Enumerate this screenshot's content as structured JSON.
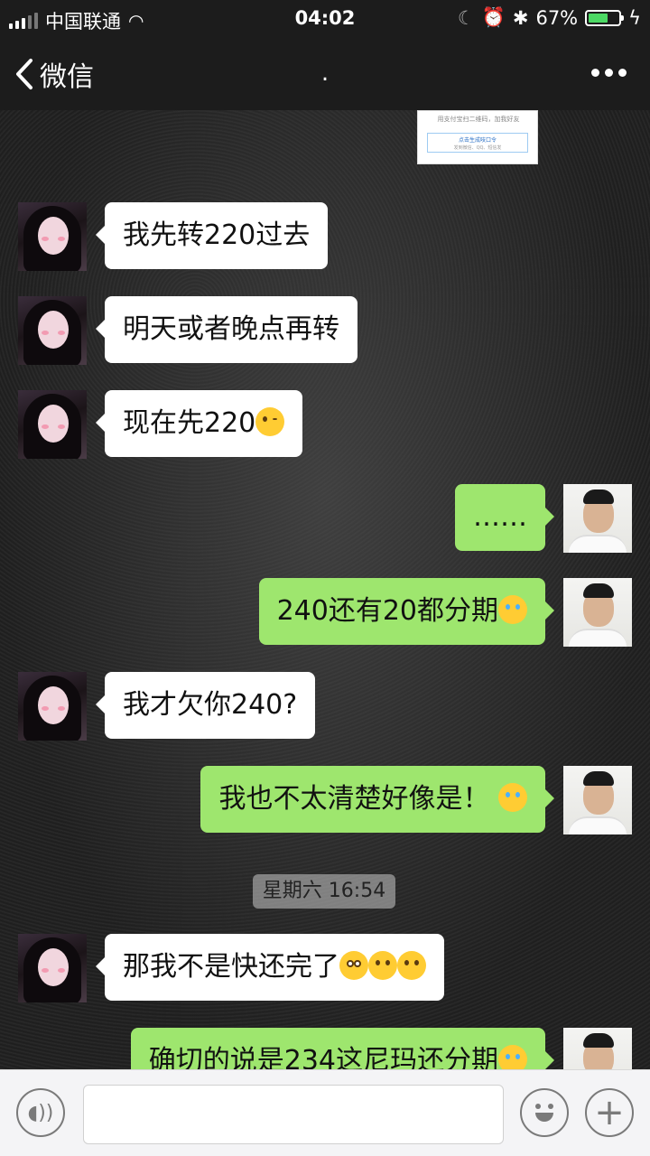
{
  "status": {
    "carrier": "中国联通",
    "time": "04:02",
    "battery_pct": "67%",
    "battery_level": 0.67,
    "battery_color": "#4cd964"
  },
  "nav": {
    "back_label": "微信",
    "title": ".",
    "back_icon": "chevron-left-icon",
    "more_icon": "more-dots-icon"
  },
  "image_msg": {
    "line1": "用支付宝扫二维码，加我好友",
    "line2": "点击生成吱口令",
    "line3": "发到微信、QQ、短信发"
  },
  "messages": [
    {
      "side": "in",
      "text": "我先转220过去",
      "emoji": []
    },
    {
      "side": "in",
      "text": "明天或者晚点再转",
      "emoji": []
    },
    {
      "side": "in",
      "text": "现在先220",
      "emoji": [
        "wink-tongue"
      ]
    },
    {
      "side": "out",
      "text": "……",
      "emoji": []
    },
    {
      "side": "out",
      "text": "240还有20都分期",
      "emoji": [
        "laugh-cry"
      ]
    },
    {
      "side": "in",
      "text": "我才欠你240?",
      "emoji": []
    },
    {
      "side": "out",
      "text": "我也不太清楚好像是！",
      "emoji": [
        "laugh-cry"
      ]
    },
    {
      "side": "in",
      "text": "那我不是快还完了",
      "emoji": [
        "shocked",
        "thinking",
        "thinking"
      ]
    },
    {
      "side": "out",
      "text": "确切的说是234这尼玛还分期",
      "emoji": [
        "laugh-cry"
      ]
    }
  ],
  "timestamp": "星期六 16:54",
  "colors": {
    "bubble_out": "#9ee66e",
    "bubble_in": "#ffffff",
    "header_bg": "#1c1c1c"
  },
  "input_bar": {
    "voice_icon": "voice-icon",
    "emoji_icon": "emoji-face-icon",
    "plus_icon": "plus-icon",
    "plus_glyph": "+"
  }
}
